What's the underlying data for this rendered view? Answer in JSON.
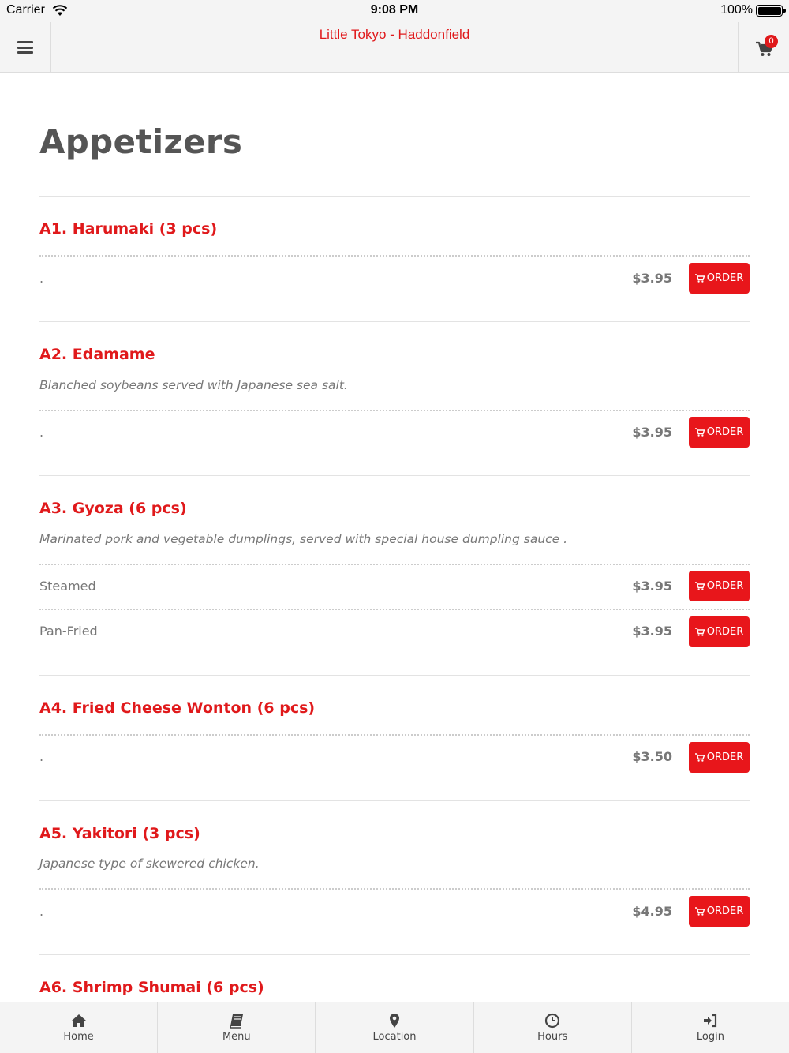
{
  "status_bar": {
    "carrier": "Carrier",
    "time": "9:08 PM",
    "battery": "100%",
    "battery_level": 1.0
  },
  "header": {
    "title": "Little Tokyo - Haddonfield",
    "menu_icon": "hamburger-icon",
    "cart_icon": "cart-icon",
    "cart_count": "0"
  },
  "category": {
    "title": "Appetizers"
  },
  "items": [
    {
      "name": "A1. Harumaki (3 pcs)",
      "description": "",
      "options": [
        {
          "label": ".",
          "price": "$3.95",
          "button": "ORDER"
        }
      ]
    },
    {
      "name": "A2. Edamame",
      "description": "Blanched soybeans served with Japanese sea salt.",
      "options": [
        {
          "label": ".",
          "price": "$3.95",
          "button": "ORDER"
        }
      ]
    },
    {
      "name": "A3. Gyoza (6 pcs)",
      "description": "Marinated pork and vegetable dumplings, served with special house dumpling sauce .",
      "options": [
        {
          "label": "Steamed",
          "price": "$3.95",
          "button": "ORDER"
        },
        {
          "label": "Pan-Fried",
          "price": "$3.95",
          "button": "ORDER"
        }
      ]
    },
    {
      "name": "A4. Fried Cheese Wonton (6 pcs)",
      "description": "",
      "options": [
        {
          "label": ".",
          "price": "$3.50",
          "button": "ORDER"
        }
      ]
    },
    {
      "name": "A5. Yakitori (3 pcs)",
      "description": "Japanese type of skewered chicken.",
      "options": [
        {
          "label": ".",
          "price": "$4.95",
          "button": "ORDER"
        }
      ]
    },
    {
      "name": "A6. Shrimp Shumai (6 pcs)",
      "description": "",
      "options": []
    }
  ],
  "bottom_nav": [
    {
      "label": "Home",
      "icon": "home-icon"
    },
    {
      "label": "Menu",
      "icon": "book-icon"
    },
    {
      "label": "Location",
      "icon": "map-pin-icon"
    },
    {
      "label": "Hours",
      "icon": "clock-icon"
    },
    {
      "label": "Login",
      "icon": "sign-in-icon"
    }
  ],
  "colors": {
    "accent": "#e0191b",
    "order_button": "#e8161b",
    "bar_background": "#f4f4f4"
  }
}
